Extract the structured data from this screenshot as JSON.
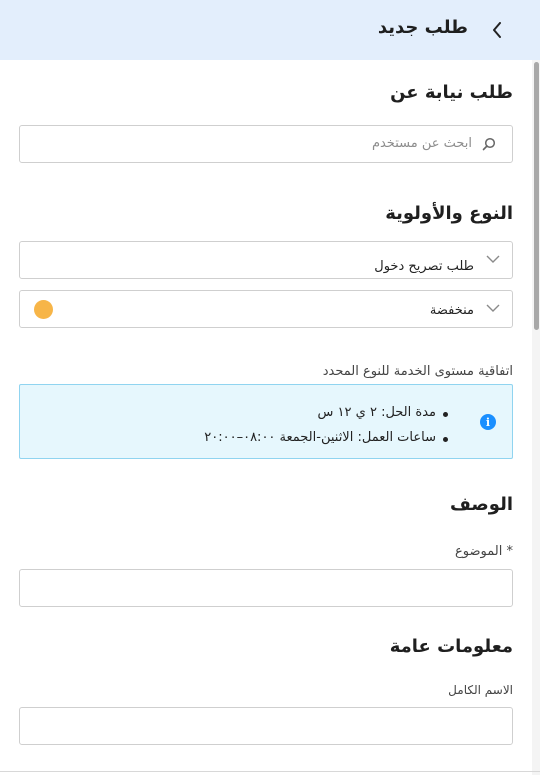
{
  "header": {
    "title": "طلب جديد"
  },
  "on_behalf": {
    "heading": "طلب نيابة عن",
    "search_placeholder": "ابحث عن مستخدم"
  },
  "type_priority": {
    "heading": "النوع والأولوية",
    "type_value": "طلب تصريح دخول",
    "priority_value": "منخفضة",
    "priority_color": "#f7b548"
  },
  "sla": {
    "label": "اتفاقية مستوى الخدمة للنوع المحدد",
    "items": [
      "مدة الحل: ٢ ي ١٢ س",
      "ساعات العمل: الاثنين-الجمعة ٠٨:٠٠–٢٠:٠٠"
    ],
    "info_color": "#1a8fff"
  },
  "description": {
    "heading": "الوصف",
    "subject_label": "* الموضوع"
  },
  "general": {
    "heading": "معلومات عامة",
    "fullname_label": "الاسم الكامل"
  },
  "icons": {
    "back": "chevron-left-icon",
    "search": "search-icon",
    "dropdown": "chevron-down-icon",
    "info": "info-icon"
  }
}
